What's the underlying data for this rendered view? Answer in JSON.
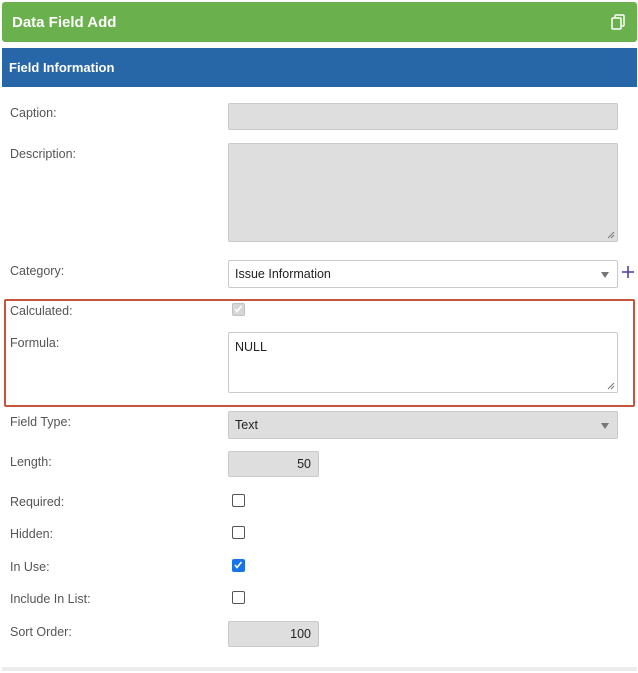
{
  "window": {
    "title": "Data Field Add",
    "icon": "copy-icon"
  },
  "section": {
    "title": "Field Information"
  },
  "fields": {
    "caption": {
      "label": "Caption:",
      "value": ""
    },
    "description": {
      "label": "Description:",
      "value": ""
    },
    "category": {
      "label": "Category:",
      "value": "Issue Information",
      "add_icon": "plus-icon"
    },
    "calculated": {
      "label": "Calculated:",
      "checked": true,
      "disabled": true
    },
    "formula": {
      "label": "Formula:",
      "value": "NULL"
    },
    "field_type": {
      "label": "Field Type:",
      "value": "Text"
    },
    "length": {
      "label": "Length:",
      "value": "50"
    },
    "required": {
      "label": "Required:",
      "checked": false
    },
    "hidden": {
      "label": "Hidden:",
      "checked": false
    },
    "in_use": {
      "label": "In Use:",
      "checked": true
    },
    "include_in_list": {
      "label": "Include In List:",
      "checked": false
    },
    "sort_order": {
      "label": "Sort Order:",
      "value": "100"
    }
  },
  "colors": {
    "title_bar": "#6ab04c",
    "section_header": "#2767a8",
    "highlight_border": "#c8533e",
    "checkbox_checked": "#1a73e8"
  }
}
